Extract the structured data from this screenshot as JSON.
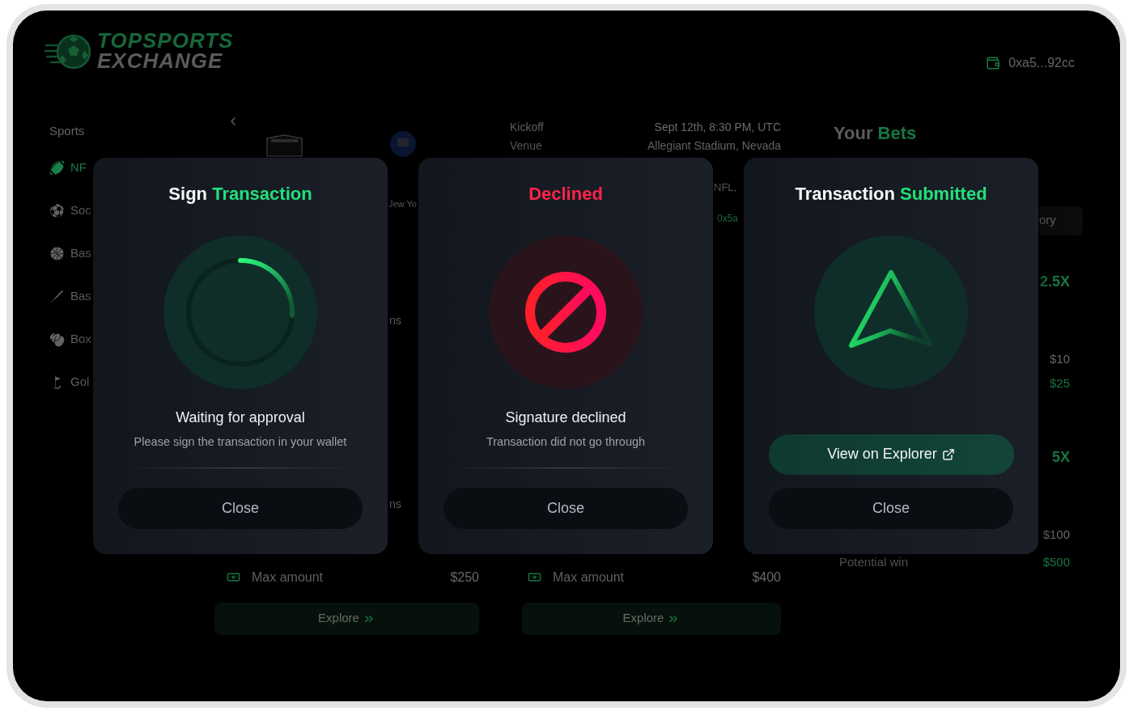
{
  "header": {
    "logo": {
      "line_1": "TOPSPORTS",
      "line_2": "EXCHANGE"
    },
    "wallet_address": "0xa5...92cc"
  },
  "sidebar": {
    "heading": "Sports",
    "items": [
      {
        "label": "NF",
        "selected": true
      },
      {
        "label": "Soc",
        "selected": false
      },
      {
        "label": "Bas",
        "selected": false
      },
      {
        "label": "Bas",
        "selected": false
      },
      {
        "label": "Box",
        "selected": false
      },
      {
        "label": "Gol",
        "selected": false
      }
    ]
  },
  "match": {
    "team_fragment": "Jew Yo",
    "details": [
      {
        "label": "Kickoff",
        "value": "Sept 12th, 8:30 PM, UTC"
      },
      {
        "label": "Venue",
        "value": "Allegiant Stadium, Nevada"
      }
    ],
    "detail_fragments": [
      {
        "kind": "text",
        "text": "NFL,"
      },
      {
        "kind": "link",
        "text": "0x5a"
      }
    ]
  },
  "markets": [
    {
      "fragments": [
        "ns",
        "ns"
      ],
      "max_amount_label": "Max amount",
      "max_amount": "$250",
      "explore_button": "Explore"
    },
    {
      "max_amount_label": "Max amount",
      "max_amount": "$400",
      "explore_button": "Explore"
    }
  ],
  "your_bets": {
    "title": [
      {
        "text": "Your",
        "accent": false
      },
      {
        "text": "Bets",
        "accent": true
      }
    ],
    "tab_fragment": "ory",
    "bets": [
      {
        "odds": "2.5X",
        "stake": "$10",
        "payout": "$25"
      },
      {
        "odds": "5X",
        "stake": "$100",
        "payout_label": "Potential win",
        "payout": "$500"
      }
    ]
  },
  "modals": [
    {
      "kind": "pending",
      "title": [
        {
          "text": "Sign",
          "accent": false
        },
        {
          "text": "Transaction",
          "accent": true
        }
      ],
      "status": "Waiting for approval",
      "message": "Please sign the transaction in your wallet",
      "close_button": "Close"
    },
    {
      "kind": "declined",
      "title": [
        {
          "text": "Declined",
          "accent": true
        }
      ],
      "status": "Signature declined",
      "message": "Transaction did not go through",
      "close_button": "Close"
    },
    {
      "kind": "submitted",
      "title": [
        {
          "text": "Transaction",
          "accent": false
        },
        {
          "text": "Submitted",
          "accent": true
        }
      ],
      "link_button": "View on Explorer",
      "close_button": "Close"
    }
  ]
}
